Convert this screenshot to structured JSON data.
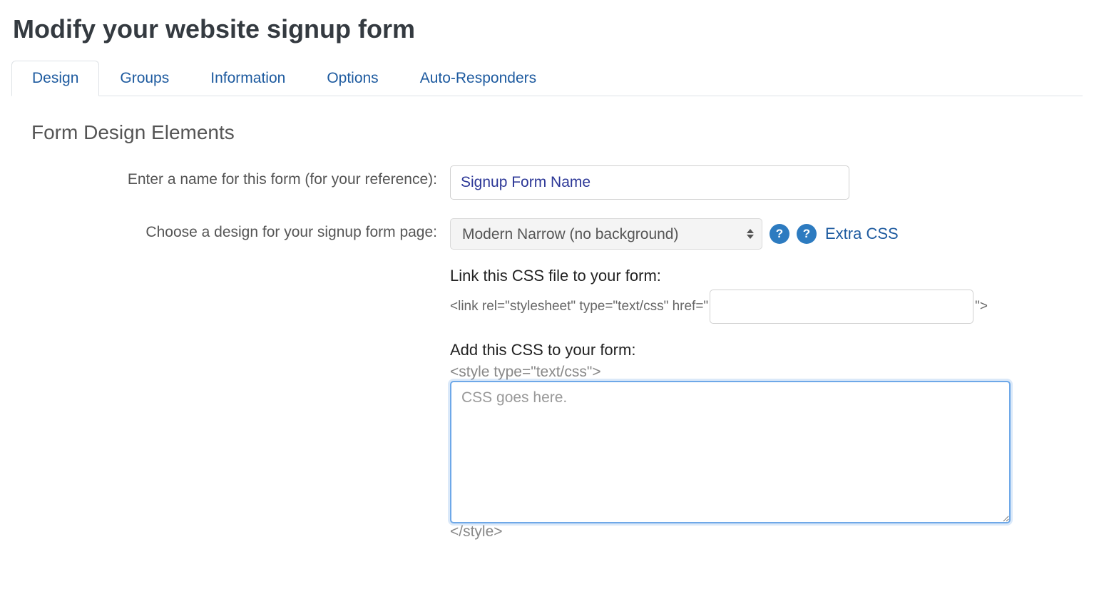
{
  "page": {
    "title": "Modify your website signup form"
  },
  "tabs": [
    {
      "label": "Design",
      "active": true
    },
    {
      "label": "Groups",
      "active": false
    },
    {
      "label": "Information",
      "active": false
    },
    {
      "label": "Options",
      "active": false
    },
    {
      "label": "Auto-Responders",
      "active": false
    }
  ],
  "section": {
    "heading": "Form Design Elements"
  },
  "form": {
    "name_label": "Enter a name for this form (for your reference):",
    "name_value": "Signup Form Name",
    "design_label": "Choose a design for your signup form page:",
    "design_selected": "Modern Narrow (no background)",
    "extra_css_label": "Extra CSS",
    "link_css_heading": "Link this CSS file to your form:",
    "link_css_prefix": "<link rel=\"stylesheet\" type=\"text/css\" href=\"",
    "link_css_value": "",
    "link_css_suffix": "\">",
    "add_css_heading": "Add this CSS to your form:",
    "style_open": "<style type=\"text/css\">",
    "css_placeholder": "CSS goes here.",
    "css_value": "",
    "style_close": "</style>"
  },
  "icons": {
    "help": "?"
  }
}
